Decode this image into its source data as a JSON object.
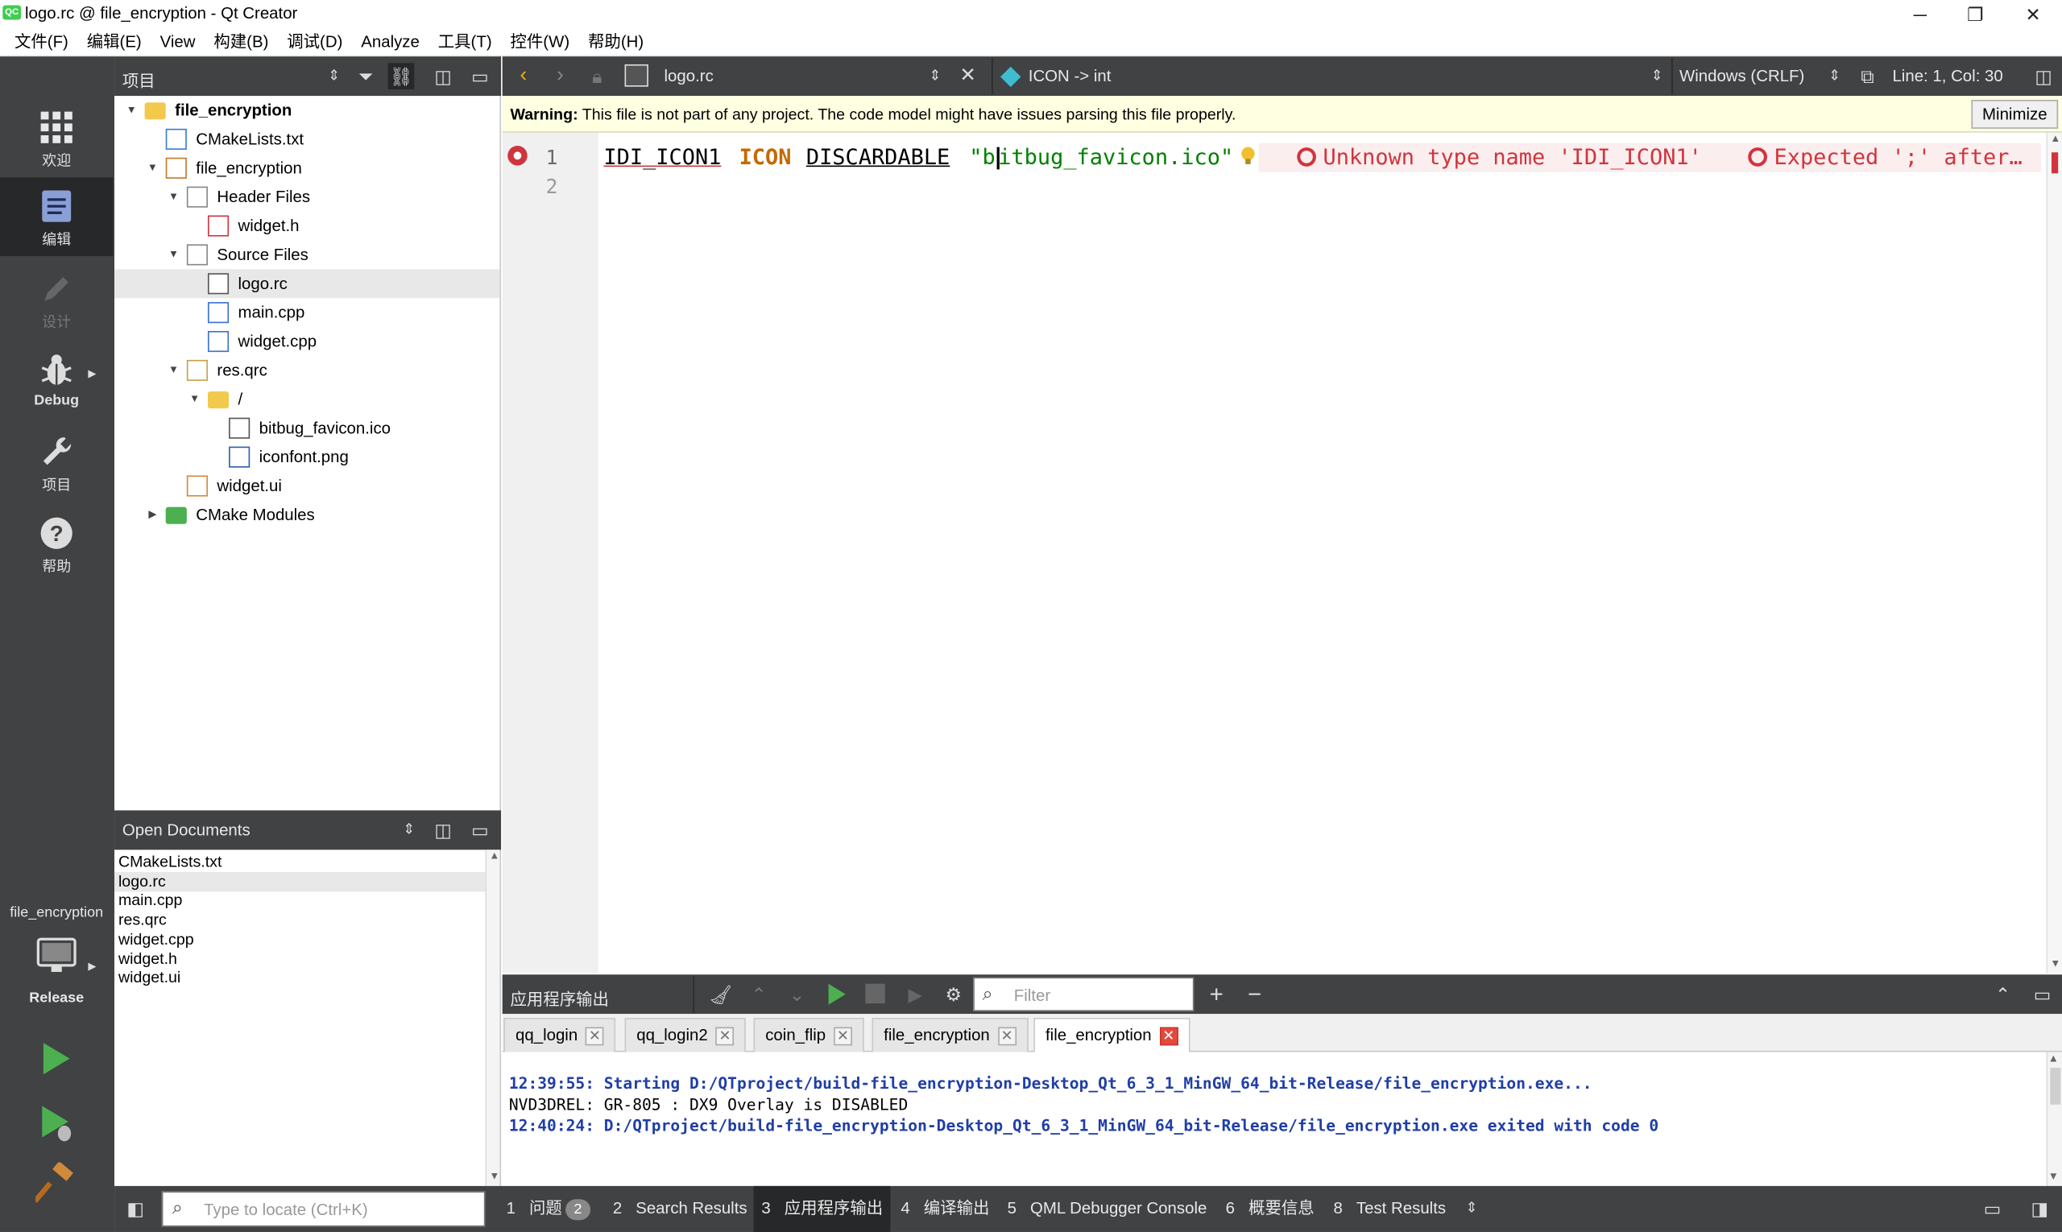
{
  "window": {
    "title": "logo.rc @ file_encryption - Qt Creator",
    "app_icon_text": "QC",
    "controls": {
      "minimize": "─",
      "restore": "❐",
      "close": "✕"
    }
  },
  "menu": [
    "文件(F)",
    "编辑(E)",
    "View",
    "构建(B)",
    "调试(D)",
    "Analyze",
    "工具(T)",
    "控件(W)",
    "帮助(H)"
  ],
  "modes": [
    {
      "label": "欢迎",
      "icon": "grid-icon"
    },
    {
      "label": "编辑",
      "icon": "document-icon"
    },
    {
      "label": "设计",
      "icon": "pencil-icon"
    },
    {
      "label": "Debug",
      "icon": "bug-icon"
    },
    {
      "label": "项目",
      "icon": "wrench-icon"
    },
    {
      "label": "帮助",
      "icon": "help-icon"
    }
  ],
  "kit": {
    "project": "file_encryption",
    "config": "Release"
  },
  "projects_pane": {
    "title": "项目",
    "tree": [
      {
        "label": "file_encryption",
        "depth": 0,
        "bold": true,
        "expanded": true,
        "icon": "project-icon"
      },
      {
        "label": "CMakeLists.txt",
        "depth": 1,
        "icon": "cmake-icon"
      },
      {
        "label": "file_encryption",
        "depth": 1,
        "expanded": true,
        "icon": "hammer-icon"
      },
      {
        "label": "Header Files",
        "depth": 2,
        "expanded": true,
        "icon": "folder-files-icon"
      },
      {
        "label": "widget.h",
        "depth": 3,
        "icon": "header-file-icon"
      },
      {
        "label": "Source Files",
        "depth": 2,
        "expanded": true,
        "icon": "folder-files-icon"
      },
      {
        "label": "logo.rc",
        "depth": 3,
        "icon": "image-file-icon",
        "selected": true
      },
      {
        "label": "main.cpp",
        "depth": 3,
        "icon": "cpp-file-icon"
      },
      {
        "label": "widget.cpp",
        "depth": 3,
        "icon": "cpp-file-icon"
      },
      {
        "label": "res.qrc",
        "depth": 2,
        "expanded": true,
        "icon": "qrc-file-icon"
      },
      {
        "label": "/",
        "depth": 3,
        "expanded": true,
        "icon": "folder-icon"
      },
      {
        "label": "bitbug_favicon.ico",
        "depth": 4,
        "icon": "ico-file-icon"
      },
      {
        "label": "iconfont.png",
        "depth": 4,
        "icon": "png-file-icon"
      },
      {
        "label": "widget.ui",
        "depth": 2,
        "icon": "ui-file-icon"
      },
      {
        "label": "CMake Modules",
        "depth": 1,
        "collapsed": true,
        "icon": "cmake-folder-icon"
      }
    ]
  },
  "open_documents": {
    "title": "Open Documents",
    "items": [
      "CMakeLists.txt",
      "logo.rc",
      "main.cpp",
      "res.qrc",
      "widget.cpp",
      "widget.h",
      "widget.ui"
    ],
    "selected": "logo.rc"
  },
  "editor": {
    "file": "logo.rc",
    "symbol": "ICON -> int",
    "line_ending": "Windows (CRLF)",
    "position": "Line: 1, Col: 30",
    "warning_prefix": "Warning:",
    "warning_text": " This file is not part of any project. The code model might have issues parsing this file properly.",
    "warning_button": "Minimize",
    "line_numbers": [
      "1",
      "2"
    ],
    "code": {
      "tok1": "IDI_ICON1",
      "tok2": "ICON",
      "tok3": "DISCARDABLE",
      "str_a": "\"b",
      "str_b": "itbug_favicon.ico\""
    },
    "diagnostics": [
      "Unknown type name 'IDI_ICON1'",
      "Expected ';' after…"
    ]
  },
  "output": {
    "title": "应用程序输出",
    "filter_placeholder": "Filter",
    "tabs": [
      "qq_login",
      "qq_login2",
      "coin_flip",
      "file_encryption",
      "file_encryption"
    ],
    "active_tab": 4,
    "lines": [
      {
        "text": "12:39:55: Starting D:/QTproject/build-file_encryption-Desktop_Qt_6_3_1_MinGW_64_bit-Release/file_encryption.exe...",
        "style": "info"
      },
      {
        "text": "NVD3DREL: GR-805 : DX9 Overlay is DISABLED",
        "style": "plain"
      },
      {
        "text": "12:40:24: D:/QTproject/build-file_encryption-Desktop_Qt_6_3_1_MinGW_64_bit-Release/file_encryption.exe exited with code 0",
        "style": "info"
      }
    ]
  },
  "statusbar": {
    "locator_placeholder": "Type to locate (Ctrl+K)",
    "panes": [
      {
        "num": "1",
        "label": "问题",
        "badge": "2"
      },
      {
        "num": "2",
        "label": "Search Results"
      },
      {
        "num": "3",
        "label": "应用程序输出",
        "active": true
      },
      {
        "num": "4",
        "label": "编译输出"
      },
      {
        "num": "5",
        "label": "QML Debugger Console"
      },
      {
        "num": "6",
        "label": "概要信息"
      },
      {
        "num": "8",
        "label": "Test Results"
      }
    ]
  },
  "colors": {
    "toolbar_bg": "#404244",
    "keyword": "#c46a00",
    "string": "#008000",
    "error": "#d0343e",
    "output_info": "#1f3ea8",
    "run_green": "#4caf50"
  }
}
